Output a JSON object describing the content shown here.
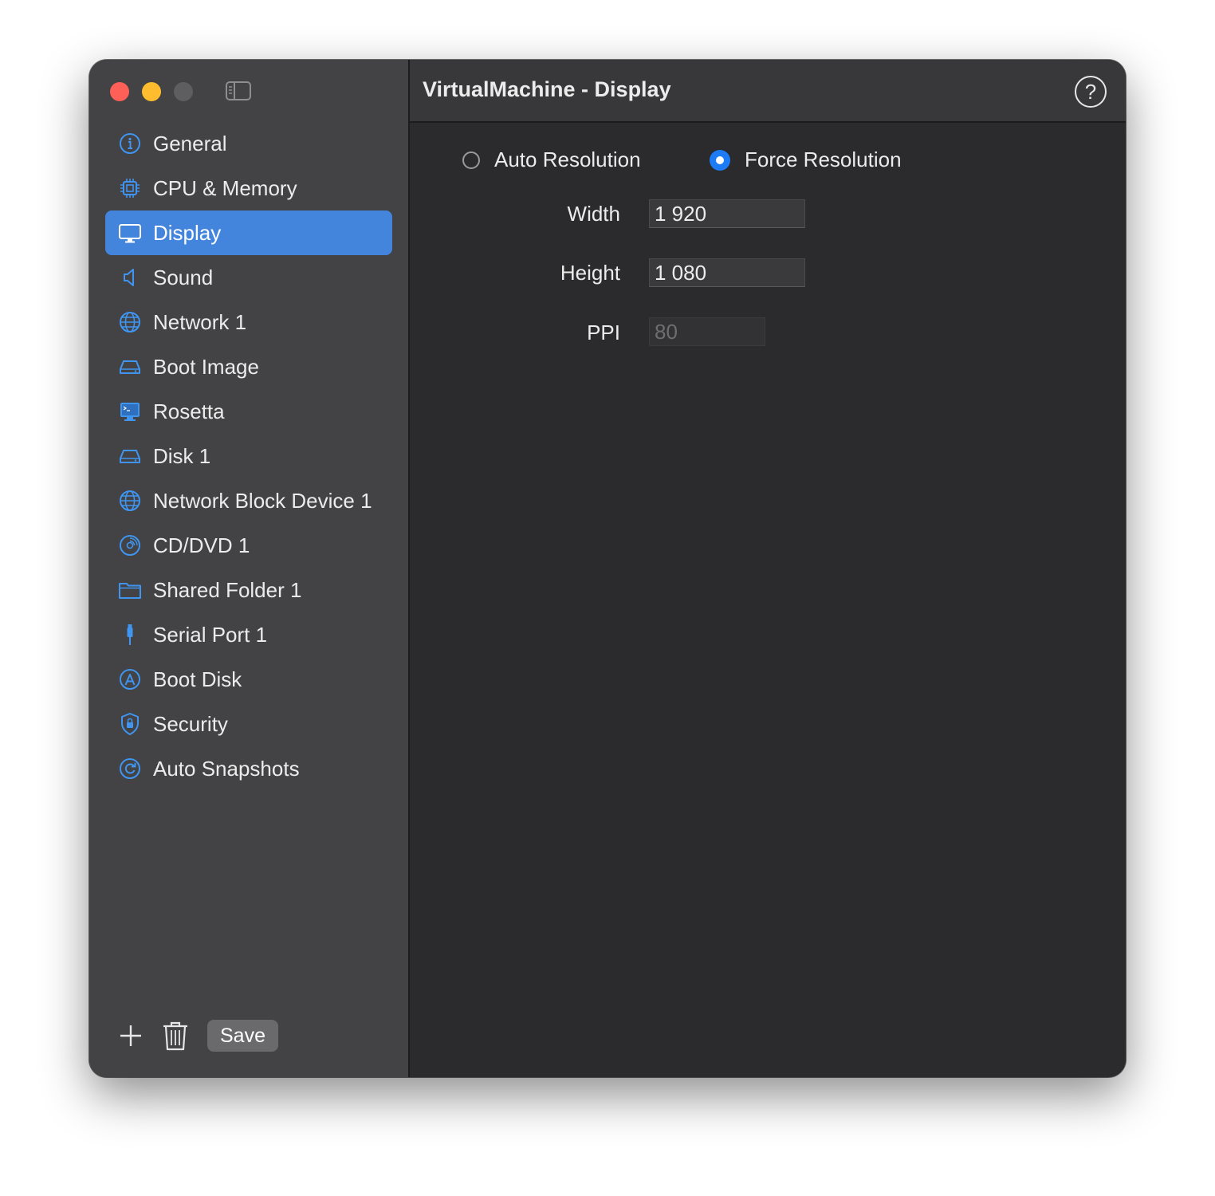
{
  "window": {
    "title": "VirtualMachine - Display"
  },
  "sidebar": {
    "items": [
      {
        "label": "General",
        "icon": "info-icon"
      },
      {
        "label": "CPU & Memory",
        "icon": "cpu-icon"
      },
      {
        "label": "Display",
        "icon": "display-icon",
        "selected": true
      },
      {
        "label": "Sound",
        "icon": "speaker-icon"
      },
      {
        "label": "Network 1",
        "icon": "globe-icon"
      },
      {
        "label": "Boot Image",
        "icon": "drive-icon"
      },
      {
        "label": "Rosetta",
        "icon": "terminal-icon"
      },
      {
        "label": "Disk 1",
        "icon": "drive-icon"
      },
      {
        "label": "Network Block Device 1",
        "icon": "globe-icon"
      },
      {
        "label": "CD/DVD 1",
        "icon": "disc-icon"
      },
      {
        "label": "Shared Folder 1",
        "icon": "folder-icon"
      },
      {
        "label": "Serial Port 1",
        "icon": "cable-icon"
      },
      {
        "label": "Boot Disk",
        "icon": "startup-disk-icon"
      },
      {
        "label": "Security",
        "icon": "shield-icon"
      },
      {
        "label": "Auto Snapshots",
        "icon": "snapshot-icon"
      }
    ],
    "save_label": "Save"
  },
  "display": {
    "resolution_options": [
      {
        "label": "Auto Resolution",
        "checked": false
      },
      {
        "label": "Force Resolution",
        "checked": true
      }
    ],
    "width": {
      "label": "Width",
      "value": "1 920"
    },
    "height": {
      "label": "Height",
      "value": "1 080"
    },
    "ppi": {
      "label": "PPI",
      "placeholder": "80"
    }
  },
  "colors": {
    "accent": "#1d7bf5",
    "selection": "#4385dd",
    "sidebar_bg": "#434244",
    "content_bg": "#2b2a2c"
  }
}
